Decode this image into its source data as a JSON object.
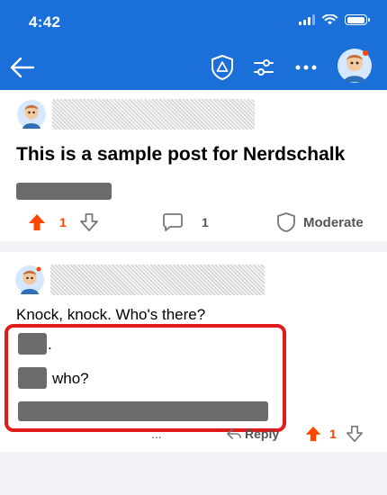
{
  "status_bar": {
    "time": "4:42"
  },
  "theme": {
    "brand": "#1a6fd8",
    "upvote": "#ff4500",
    "highlight": "#e01b1b"
  },
  "nav": {
    "icons": [
      "back-arrow-icon",
      "shield-icon",
      "sliders-icon",
      "more-icon",
      "avatar"
    ]
  },
  "post": {
    "title": "This is a sample post for Nerdschalk",
    "vote_count": "1",
    "comment_count": "1",
    "moderate_label": "Moderate"
  },
  "comment": {
    "text": "Knock, knock. Who's there?",
    "line1_suffix": ".",
    "line2_suffix": "who?",
    "vote_count": "1",
    "reply_label": "Reply",
    "more_label": "..."
  }
}
